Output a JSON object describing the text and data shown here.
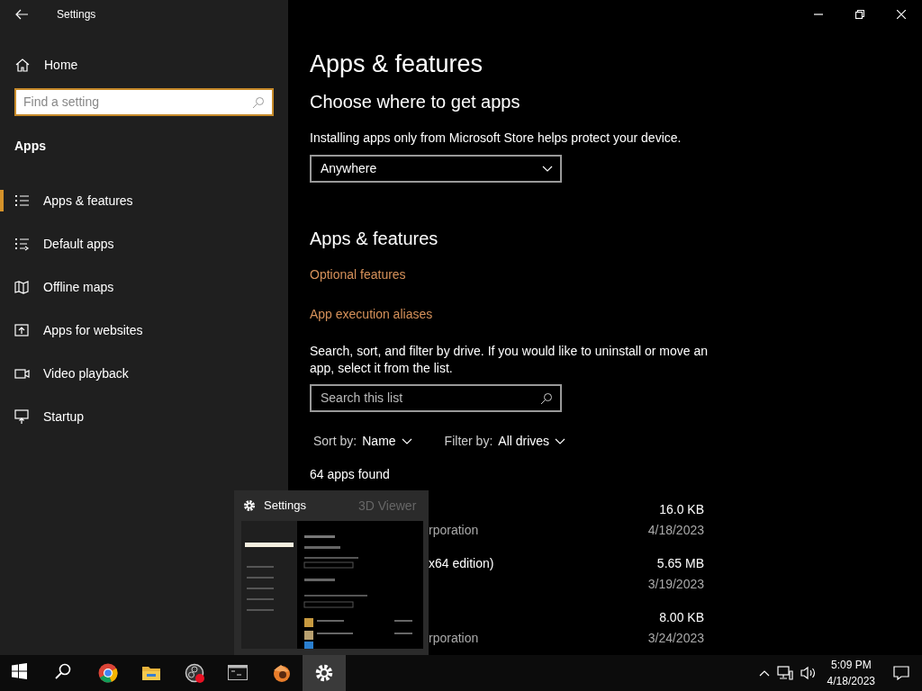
{
  "window": {
    "title": "Settings"
  },
  "sidebar": {
    "home": "Home",
    "search": {
      "placeholder": "Find a setting"
    },
    "section": "Apps",
    "items": [
      {
        "label": "Apps & features",
        "kind": "list",
        "selected": true
      },
      {
        "label": "Default apps",
        "kind": "default",
        "selected": false
      },
      {
        "label": "Offline maps",
        "kind": "map",
        "selected": false
      },
      {
        "label": "Apps for websites",
        "kind": "web",
        "selected": false
      },
      {
        "label": "Video playback",
        "kind": "video",
        "selected": false
      },
      {
        "label": "Startup",
        "kind": "startup",
        "selected": false
      }
    ]
  },
  "main": {
    "title": "Apps & features",
    "get_apps": {
      "heading": "Choose where to get apps",
      "description": "Installing apps only from Microsoft Store helps protect your device.",
      "dropdown": "Anywhere"
    },
    "features": {
      "heading": "Apps & features",
      "links": [
        "Optional features",
        "App execution aliases"
      ],
      "description": "Search, sort, and filter by drive. If you would like to uninstall or move an app, select it from the list.",
      "search": {
        "placeholder": "Search this list"
      },
      "sort": {
        "label": "Sort by:",
        "value": "Name"
      },
      "filter": {
        "label": "Filter by:",
        "value": "All drives"
      },
      "count": "64 apps found",
      "apps": [
        {
          "publisher": "rporation",
          "size": "16.0 KB",
          "date": "4/18/2023"
        },
        {
          "name": "x64 edition)",
          "size": "5.65 MB",
          "date": "3/19/2023"
        },
        {
          "publisher": "rporation",
          "size": "8.00 KB",
          "date": "3/24/2023"
        }
      ]
    }
  },
  "thumbnail_preview": {
    "title": "Settings",
    "behind_text": "3D Viewer"
  },
  "taskbar": {
    "apps": [
      {
        "kind": "start",
        "selected": false
      },
      {
        "kind": "search",
        "selected": false
      },
      {
        "kind": "chrome",
        "selected": false
      },
      {
        "kind": "folder",
        "selected": false
      },
      {
        "kind": "obs",
        "selected": false
      },
      {
        "kind": "terminal",
        "selected": false
      },
      {
        "kind": "blender",
        "selected": false
      },
      {
        "kind": "settings",
        "selected": true
      }
    ],
    "time": "5:09 PM",
    "date": "4/18/2023"
  }
}
